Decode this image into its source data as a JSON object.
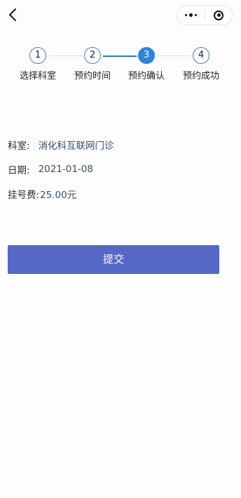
{
  "nav": {
    "back_icon": "chevron-left-icon",
    "more_icon": "more-dots-icon",
    "close_icon": "target-close-icon"
  },
  "stepper": {
    "active_step": 3,
    "steps": [
      {
        "number": "1",
        "label": "选择科室"
      },
      {
        "number": "2",
        "label": "预约时间"
      },
      {
        "number": "3",
        "label": "预约确认"
      },
      {
        "number": "4",
        "label": "预约成功"
      }
    ]
  },
  "details": {
    "department_label": "科室:",
    "department_value": "消化科互联网门诊",
    "date_label": "日期:",
    "date_value": "2021-01-08",
    "fee_label": "挂号费:",
    "fee_value": "25.00元"
  },
  "submit": {
    "label": "提交"
  },
  "colors": {
    "accent": "#2f84d8",
    "submit_bg": "#5668c6",
    "step_border": "#3d8a98"
  }
}
